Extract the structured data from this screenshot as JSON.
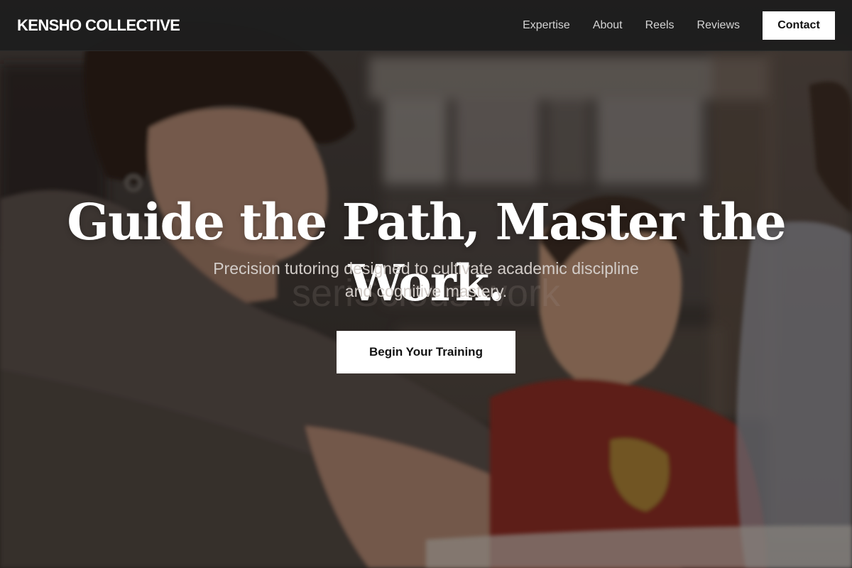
{
  "navbar": {
    "brand": "KENSHO COLLECTIVE",
    "links": [
      {
        "label": "Expertise"
      },
      {
        "label": "About"
      },
      {
        "label": "Reels"
      },
      {
        "label": "Reviews"
      }
    ],
    "contact_label": "Contact"
  },
  "hero": {
    "title": "Guide the Path, Master the Work.",
    "subtitle": "Precision tutoring designed to cultivate academic discipline and cognitive mastery.",
    "watermark": "seriScious work",
    "cta_label": "Begin Your Training",
    "image_description": "teacher-and-child-reading-photo"
  },
  "colors": {
    "navbar_bg": "#1e1e1e",
    "button_bg": "#ffffff",
    "button_text": "#111111",
    "title_text": "#ffffff"
  }
}
